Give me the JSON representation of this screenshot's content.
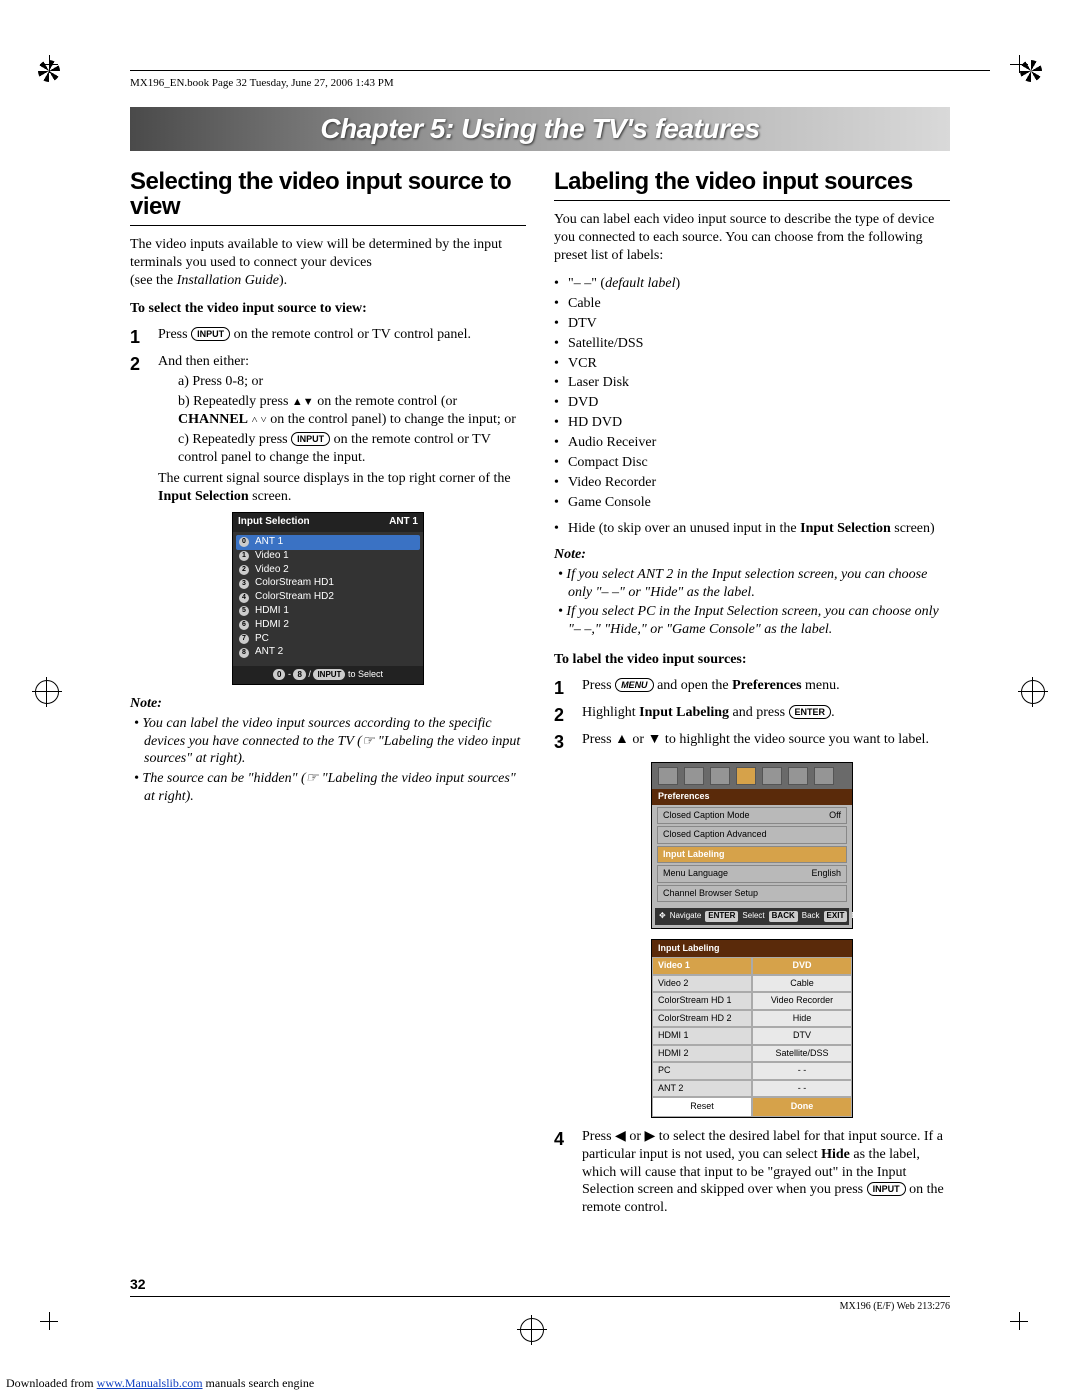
{
  "header": {
    "book_page": "MX196_EN.book  Page 32  Tuesday, June 27, 2006  1:43 PM"
  },
  "chapter_title": "Chapter 5: Using the TV's features",
  "left": {
    "h2": "Selecting the video input source to view",
    "intro1": "The video inputs available to view will be determined by the input terminals you used to connect your devices",
    "intro2_prefix": "(see the ",
    "intro2_italic": "Installation Guide",
    "intro2_suffix": ").",
    "subhead": "To select the video input source to view:",
    "step1_a": "Press ",
    "step1_btn": "INPUT",
    "step1_b": " on the remote control or TV control panel.",
    "step2_lead": "And then either:",
    "step2a": "a) Press 0-8; or",
    "step2b_a": "b) Repeatedly press ",
    "step2b_b": " on the remote control (or ",
    "step2b_bold": "CHANNEL",
    "step2b_c": " on the control panel) to change the input; or",
    "step2c_a": "c) Repeatedly press ",
    "step2c_btn": "INPUT",
    "step2c_b": " on the remote control or TV control panel to change the input.",
    "step2_tail_a": "The current signal source displays in the top right corner of the ",
    "step2_tail_bold": "Input Selection",
    "step2_tail_b": " screen.",
    "osd": {
      "title": "Input Selection",
      "indicator": "ANT 1",
      "items": [
        {
          "n": "0",
          "label": "ANT 1",
          "hl": true
        },
        {
          "n": "1",
          "label": "Video 1"
        },
        {
          "n": "2",
          "label": "Video 2"
        },
        {
          "n": "3",
          "label": "ColorStream HD1"
        },
        {
          "n": "4",
          "label": "ColorStream HD2"
        },
        {
          "n": "5",
          "label": "HDMI 1"
        },
        {
          "n": "6",
          "label": "HDMI 2"
        },
        {
          "n": "7",
          "label": "PC"
        },
        {
          "n": "8",
          "label": "ANT 2"
        }
      ],
      "footer_a": "0",
      "footer_b": "8",
      "footer_btn": "INPUT",
      "footer_c": "to Select"
    },
    "note_label": "Note:",
    "note1_a": "• You can label the video input sources according to the specific devices you have connected to the TV (☞ \"Labeling the video input sources\" at right).",
    "note2_a": "• The source can be \"hidden\" (☞ \"Labeling the video input sources\" at right)."
  },
  "right": {
    "h2": "Labeling the video input sources",
    "intro": "You can label each video input source to describe the type of device you connected to each source. You can choose from the following preset list of labels:",
    "labels": [
      "\"– –\" (default label)",
      "Cable",
      "DTV",
      "Satellite/DSS",
      "VCR",
      "Laser Disk",
      "DVD",
      "HD DVD",
      "Audio Receiver",
      "Compact Disc",
      "Video Recorder",
      "Game Console"
    ],
    "labels_hide_a": "Hide (to skip over an unused input in the ",
    "labels_hide_bold": "Input Selection",
    "labels_hide_b": " screen)",
    "note_label": "Note:",
    "note1": "• If you select ANT 2 in the Input selection screen, you can choose only \"– –\" or \"Hide\" as the label.",
    "note2": "• If you select PC in the Input Selection screen, you can choose only \"– –,\" \"Hide,\" or \"Game Console\" as the label.",
    "subhead": "To label the video input sources:",
    "step1_a": "Press ",
    "step1_btn": "MENU",
    "step1_b": " and open the ",
    "step1_bold": "Preferences",
    "step1_c": " menu.",
    "step2_a": "Highlight ",
    "step2_bold": "Input Labeling",
    "step2_b": " and press ",
    "step2_btn": "ENTER",
    "step2_c": ".",
    "step3_a": "Press ▲ or ▼ to highlight the video source you want to label.",
    "pref": {
      "title": "Preferences",
      "rows": [
        {
          "l": "Closed Caption Mode",
          "r": "Off"
        },
        {
          "l": "Closed Caption Advanced",
          "r": ""
        },
        {
          "l": "Input Labeling",
          "r": "",
          "sel": true
        },
        {
          "l": "Menu Language",
          "r": "English"
        },
        {
          "l": "Channel Browser Setup",
          "r": ""
        }
      ],
      "foot_nav": "Navigate",
      "foot_sel": "Select",
      "foot_sel_tag": "ENTER",
      "foot_back": "Back",
      "foot_back_tag": "BACK",
      "foot_exit": "Exit",
      "foot_exit_tag": "EXIT"
    },
    "lbltable": {
      "title": "Input Labeling",
      "rows": [
        {
          "l": "Video 1",
          "r": "DVD",
          "hl": true
        },
        {
          "l": "Video 2",
          "r": "Cable"
        },
        {
          "l": "ColorStream HD 1",
          "r": "Video Recorder"
        },
        {
          "l": "ColorStream HD 2",
          "r": "Hide"
        },
        {
          "l": "HDMI 1",
          "r": "DTV"
        },
        {
          "l": "HDMI 2",
          "r": "Satellite/DSS"
        },
        {
          "l": "PC",
          "r": "- -"
        },
        {
          "l": "ANT 2",
          "r": "- -"
        }
      ],
      "reset": "Reset",
      "done": "Done"
    },
    "step4_a": "Press ◀ or ▶ to select the desired label for that input source. If a particular input is not used, you can select ",
    "step4_bold": "Hide",
    "step4_b": " as the label, which will cause that input to be \"grayed out\" in the Input Selection screen and skipped over when you press ",
    "step4_btn": "INPUT",
    "step4_c": " on the remote control."
  },
  "footer": {
    "pagenum": "32",
    "right": "MX196 (E/F) Web 213:276",
    "src_a": "Downloaded from ",
    "src_link": "www.Manualslib.com",
    "src_b": " manuals search engine"
  }
}
